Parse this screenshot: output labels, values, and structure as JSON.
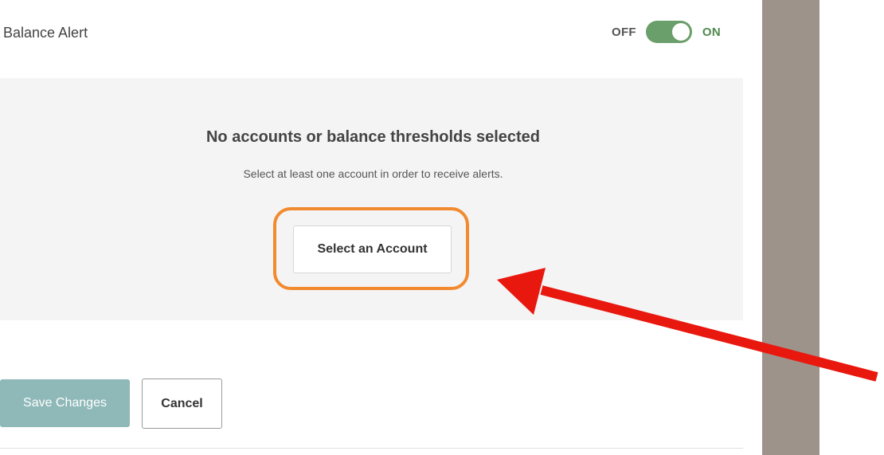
{
  "alert": {
    "title": "Balance Alert",
    "toggle": {
      "off_label": "OFF",
      "on_label": "ON",
      "state": "on"
    }
  },
  "empty_state": {
    "title": "No accounts or balance thresholds selected",
    "subtitle": "Select at least one account in order to receive alerts.",
    "button_label": "Select an Account"
  },
  "actions": {
    "save_label": "Save Changes",
    "cancel_label": "Cancel"
  },
  "colors": {
    "toggle_on": "#6a9e6a",
    "save_button": "#8fb8b8",
    "highlight": "#f28a30",
    "arrow": "#e8180f",
    "side_strip": "#9e938b"
  }
}
